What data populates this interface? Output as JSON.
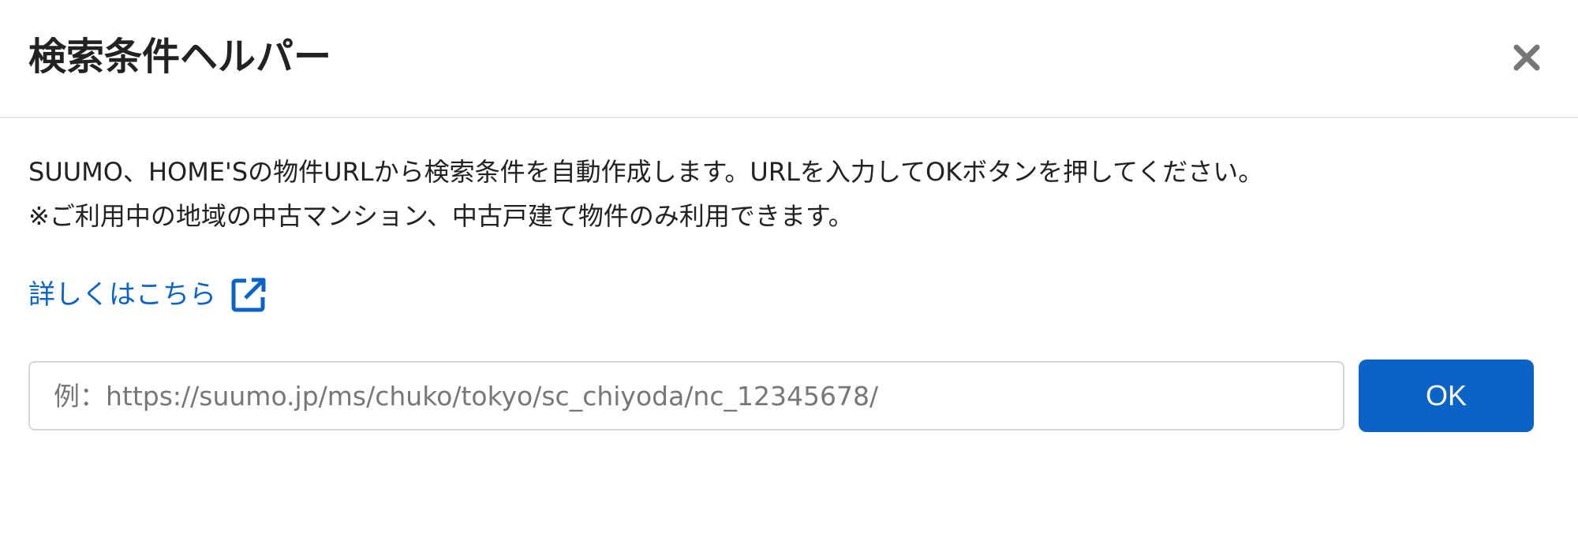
{
  "dialog": {
    "title": "検索条件ヘルパー",
    "close_icon": "close-icon"
  },
  "description": {
    "line1": "SUUMO、HOME'Sの物件URLから検索条件を自動作成します。URLを入力してOKボタンを押してください。",
    "line2": "※ご利用中の地域の中古マンション、中古戸建て物件のみ利用できます。"
  },
  "detail_link": {
    "label": "詳しくはこちら",
    "icon": "external-link-icon"
  },
  "url_input": {
    "value": "",
    "placeholder": "例：https://suumo.jp/ms/chuko/tokyo/sc_chiyoda/nc_12345678/"
  },
  "ok_button": {
    "label": "OK"
  },
  "colors": {
    "accent": "#0b63c7",
    "title_text": "#222222",
    "placeholder_text": "#777777",
    "close_icon": "#777777",
    "divider": "#e4e4e4"
  }
}
